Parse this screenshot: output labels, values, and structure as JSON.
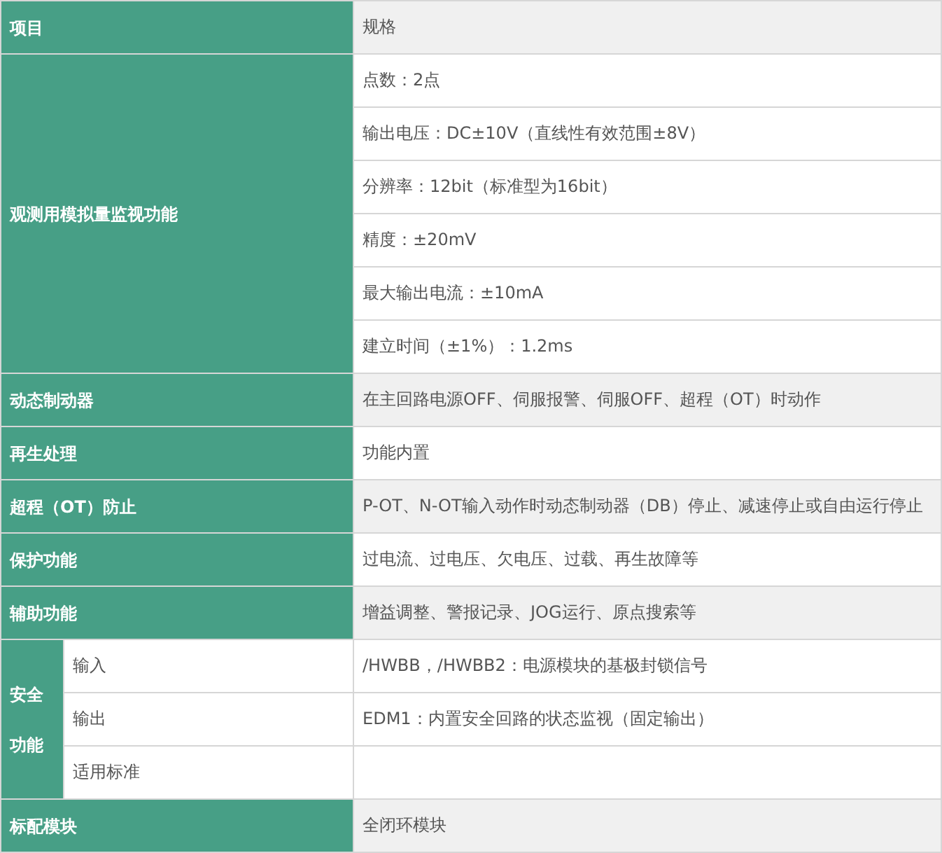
{
  "header": {
    "item": "项目",
    "spec": "规格"
  },
  "groups": [
    {
      "label": "观测用模拟量监视功能",
      "rows": [
        {
          "spec": "点数：2点"
        },
        {
          "spec": "输出电压：DC±10V（直线性有效范围±8V）"
        },
        {
          "spec": "分辨率：12bit（标准型为16bit）"
        },
        {
          "spec": "精度：±20mV"
        },
        {
          "spec": "最大输出电流：±10mA"
        },
        {
          "spec": "建立时间（±1%）：1.2ms"
        }
      ]
    },
    {
      "label": "动态制动器",
      "rows": [
        {
          "spec": "在主回路电源OFF、伺服报警、伺服OFF、超程（OT）时动作"
        }
      ]
    },
    {
      "label": "再生处理",
      "rows": [
        {
          "spec": "功能内置"
        }
      ]
    },
    {
      "label": "超程（OT）防止",
      "rows": [
        {
          "spec": "P-OT、N-OT输入动作时动态制动器（DB）停止、减速停止或自由运行停止"
        }
      ]
    },
    {
      "label": "保护功能",
      "rows": [
        {
          "spec": "过电流、过电压、欠电压、过载、再生故障等"
        }
      ]
    },
    {
      "label": "辅助功能",
      "rows": [
        {
          "spec": "增益调整、警报记录、JOG运行、原点搜索等"
        }
      ]
    },
    {
      "label": "安全功能",
      "rows": [
        {
          "sublabel": "输入",
          "spec": "/HWBB，/HWBB2：电源模块的基极封锁信号"
        },
        {
          "sublabel": "输出",
          "spec": "EDM1：内置安全回路的状态监视（固定输出）"
        },
        {
          "sublabel": "适用标准"
        }
      ]
    },
    {
      "label": "标配模块",
      "rows": [
        {
          "spec": "全闭环模块"
        }
      ]
    }
  ]
}
